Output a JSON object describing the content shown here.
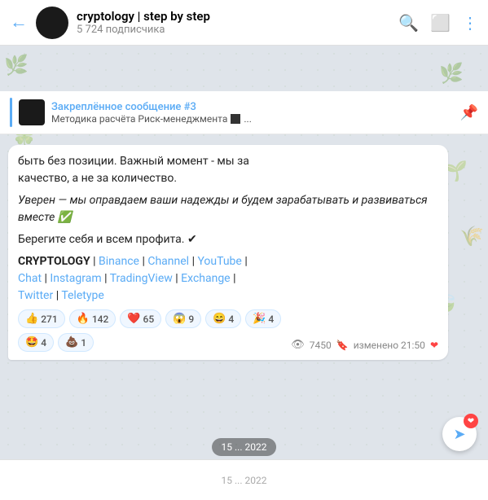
{
  "header": {
    "back_icon": "←",
    "title": "cryptology | step by step",
    "subtitle": "5 724 подписчика",
    "search_icon": "🔍",
    "layout_icon": "⬜",
    "more_icon": "⋮"
  },
  "pinned": {
    "title": "Закреплённое сообщение #3",
    "description": "Методика расчёта Риск-менеджмента",
    "action_icon": "📌"
  },
  "message": {
    "text_line1": "быть без позиции. Важный момент - мы за",
    "text_line2": "качество, а не за количество.",
    "italic_line": "Уверен — мы оправдаем ваши надежды и будем зарабатывать и развиваться вместе ✅",
    "line3": "Берегите себя и всем профита. ✔",
    "links_label": "CRYPTOLOGY",
    "links": [
      {
        "label": "CRYPTOLOGY",
        "bold": true
      },
      {
        "label": " | "
      },
      {
        "label": "Binance",
        "link": true
      },
      {
        "label": " | "
      },
      {
        "label": "Channel",
        "link": true
      },
      {
        "label": " | "
      },
      {
        "label": "YouTube",
        "link": true
      },
      {
        "label": " | "
      },
      {
        "label": "Chat",
        "link": true
      },
      {
        "label": " | "
      },
      {
        "label": "Instagram",
        "link": true
      },
      {
        "label": " | "
      },
      {
        "label": "TradingView",
        "link": true
      },
      {
        "label": " | "
      },
      {
        "label": "Exchange",
        "link": true
      },
      {
        "label": " | "
      },
      {
        "label": "Twitter",
        "link": true
      },
      {
        "label": " | "
      },
      {
        "label": "Teletype",
        "link": true
      }
    ],
    "reactions": [
      {
        "emoji": "👍",
        "count": "271"
      },
      {
        "emoji": "🔥",
        "count": "142"
      },
      {
        "emoji": "❤️",
        "count": "65"
      },
      {
        "emoji": "😱",
        "count": "9"
      },
      {
        "emoji": "😄",
        "count": "4"
      },
      {
        "emoji": "🎉",
        "count": "4"
      },
      {
        "emoji": "🤩",
        "count": "4"
      },
      {
        "emoji": "💩",
        "count": "1"
      }
    ],
    "views": "7450",
    "edit_label": "изменено 21:50"
  },
  "bottom": {
    "page_indicator": "15 ... 2022",
    "forward_icon": "➤",
    "heart_badge": "❤"
  },
  "bg_emojis": [
    "🌿",
    "🍀",
    "🌱",
    "🌾",
    "🍃"
  ]
}
